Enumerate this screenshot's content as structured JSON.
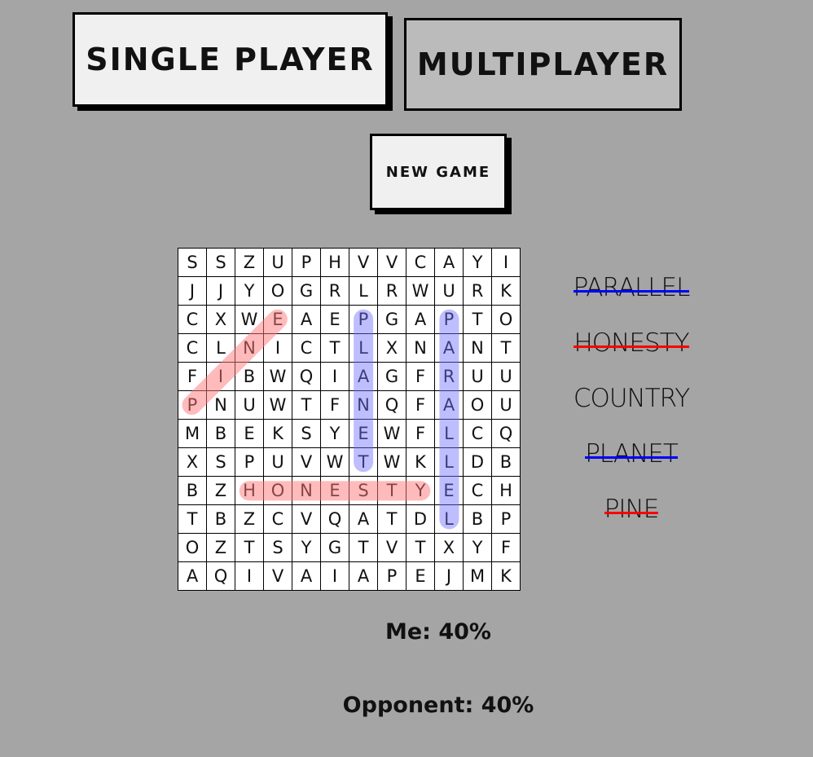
{
  "buttons": {
    "single_player": "SINGLE PLAYER",
    "multiplayer": "MULTIPLAYER",
    "new_game": "NEW GAME"
  },
  "grid": [
    "SSZUPHVVCAYI",
    "JJYOGRLRWURK",
    "CXWEAEPGAPTO",
    "CLNICTLXNANT",
    "FIBWQIAGFRUU",
    "PNUWTFNQFAOU",
    "MBEKSYEWFLCQ",
    "XSPUVWTWKLDB",
    "BZHONESTYECH",
    "TBZCVQATDLBP",
    "OZTSYGTVTXYF",
    "AQIVAIAPEJMK"
  ],
  "found": [
    {
      "word": "PINE",
      "player": "red",
      "from": [
        6,
        1
      ],
      "to": [
        3,
        4
      ]
    },
    {
      "word": "PLANET",
      "player": "blue",
      "from": [
        3,
        7
      ],
      "to": [
        8,
        7
      ]
    },
    {
      "word": "PARALLEL",
      "player": "blue",
      "from": [
        3,
        10
      ],
      "to": [
        10,
        10
      ]
    },
    {
      "word": "HONESTY",
      "player": "red",
      "from": [
        9,
        3
      ],
      "to": [
        9,
        9
      ]
    }
  ],
  "colors": {
    "red": "#ff0000",
    "blue": "#0000ff",
    "red_highlight": "rgba(255,120,120,0.5)",
    "blue_highlight": "rgba(110,110,255,0.45)"
  },
  "word_list": [
    {
      "word": "PARALLEL",
      "found_by": "blue"
    },
    {
      "word": "HONESTY",
      "found_by": "red"
    },
    {
      "word": "COUNTRY",
      "found_by": null
    },
    {
      "word": "PLANET",
      "found_by": "blue"
    },
    {
      "word": "PINE",
      "found_by": "red"
    }
  ],
  "scores": {
    "me": "Me: 40%",
    "opponent": "Opponent: 40%"
  }
}
